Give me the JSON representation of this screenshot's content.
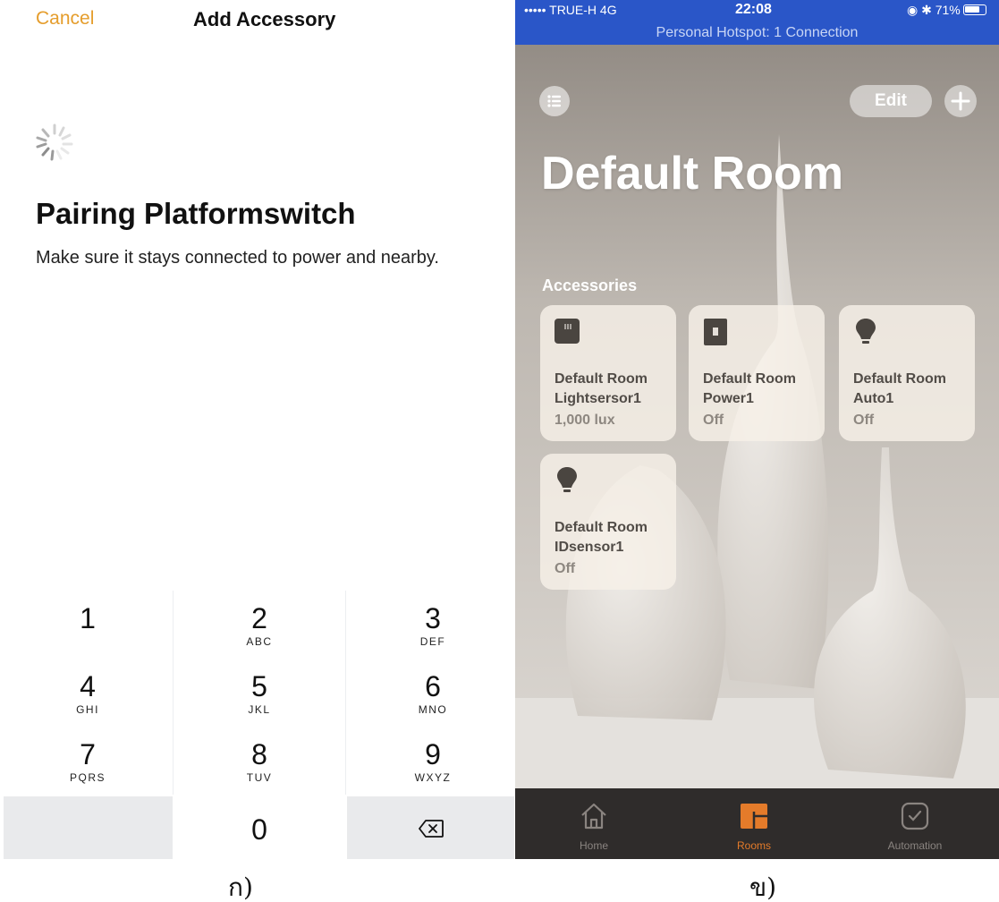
{
  "left_panel": {
    "nav": {
      "cancel_label": "Cancel",
      "title": "Add Accessory"
    },
    "title": "Pairing Platformswitch",
    "subtitle": "Make sure it stays connected to power and nearby.",
    "keypad": [
      {
        "digit": "1",
        "letters": ""
      },
      {
        "digit": "2",
        "letters": "ABC"
      },
      {
        "digit": "3",
        "letters": "DEF"
      },
      {
        "digit": "4",
        "letters": "GHI"
      },
      {
        "digit": "5",
        "letters": "JKL"
      },
      {
        "digit": "6",
        "letters": "MNO"
      },
      {
        "digit": "7",
        "letters": "PQRS"
      },
      {
        "digit": "8",
        "letters": "TUV"
      },
      {
        "digit": "9",
        "letters": "WXYZ"
      },
      {
        "digit": "0",
        "letters": ""
      }
    ],
    "delete_icon": "backspace-icon",
    "caption": "ก)"
  },
  "right_panel": {
    "status_bar": {
      "carrier": "••••• TRUE-H  4G",
      "time": "22:08",
      "battery": "71%",
      "hotspot": "Personal Hotspot: 1 Connection"
    },
    "toolbar": {
      "edit_label": "Edit",
      "list_icon": "list-icon",
      "add_icon": "plus-icon"
    },
    "room_title": "Default Room",
    "section_label": "Accessories",
    "accessories": [
      {
        "line1": "Default Room",
        "line2": "Lightsersor1",
        "status": "1,000 lux",
        "icon": "sensor-icon"
      },
      {
        "line1": "Default Room",
        "line2": "Power1",
        "status": "Off",
        "icon": "switch-icon"
      },
      {
        "line1": "Default Room",
        "line2": "Auto1",
        "status": "Off",
        "icon": "lightbulb-icon"
      },
      {
        "line1": "Default Room",
        "line2": "IDsensor1",
        "status": "Off",
        "icon": "lightbulb-icon"
      }
    ],
    "tabs": [
      {
        "label": "Home",
        "icon": "home-icon",
        "active": false
      },
      {
        "label": "Rooms",
        "icon": "rooms-icon",
        "active": true
      },
      {
        "label": "Automation",
        "icon": "clock-icon",
        "active": false
      }
    ],
    "colors": {
      "accent": "#e47b2a",
      "status_bar": "#2a56c8",
      "cancel": "#e59d2c"
    },
    "caption": "ข)"
  }
}
